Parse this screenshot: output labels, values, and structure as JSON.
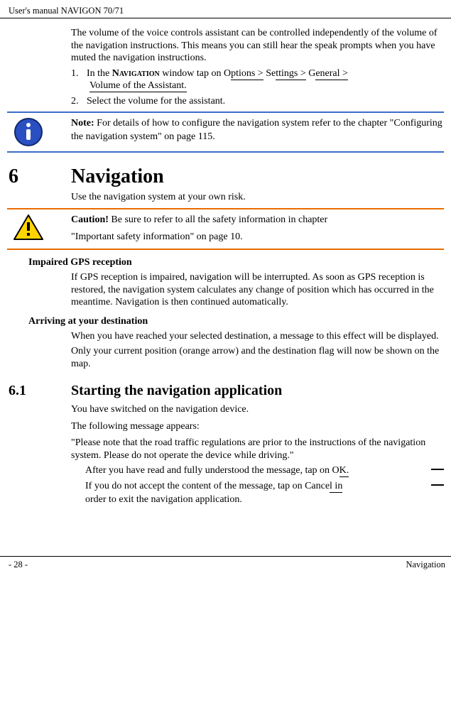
{
  "header": {
    "manual_title": "User's manual NAVIGON 70/71"
  },
  "intro": {
    "para": "The volume of the voice controls assistant can be controlled independently of the volume of the navigation instructions. This means you can still hear the speak prompts when you have muted the navigation instructions.",
    "step1_pre": "In the ",
    "step1_nav": "Navigation",
    "step1_mid": " window tap on O",
    "step1_u1": "ptions >",
    "step1_mid2": " Se",
    "step1_u2": "ttings >",
    "step1_mid3": " G",
    "step1_u3": "eneral >",
    "step1_line2": "Volume of the Assistant.",
    "step2": "Select the volume for the assistant."
  },
  "note": {
    "label": "Note:",
    "text": " For details of how to configure the navigation system refer to the chapter \"Configuring the navigation system\" on page 115."
  },
  "chapter": {
    "num": "6",
    "title": "Navigation",
    "para": "Use the navigation system at your own risk."
  },
  "caution": {
    "label": "Caution!",
    "line1_rest": " Be sure to refer to all the safety information in chapter",
    "line2": "\"Important safety information\" on page 10."
  },
  "gps": {
    "head": "Impaired GPS reception",
    "para": "If GPS reception is impaired, navigation will be interrupted. As soon as GPS reception is restored, the navigation system calculates any change of position which has occurred in the meantime. Navigation is then continued automatically."
  },
  "arrive": {
    "head": "Arriving at your destination",
    "p1": "When you have reached your selected destination, a message to this effect will be displayed.",
    "p2": "Only your current position (orange arrow) and the destination flag will now be shown on the map."
  },
  "section": {
    "num": "6.1",
    "title": "Starting the navigation application",
    "p1": "You have switched on the navigation device.",
    "p2": "The following message appears:",
    "p3": "\"Please note that the road traffic regulations are prior to the instructions of the navigation system. Please do not operate the device while driving.\"",
    "b1a": "After you have read and fully understood the message, tap on O",
    "b1b": "K.",
    "b2a": "If you do not accept the content of the message, tap on Cance",
    "b2b": "l in",
    "b2c": "order to exit the navigation application."
  },
  "footer": {
    "page": "- 28 -",
    "section": "Navigation"
  }
}
